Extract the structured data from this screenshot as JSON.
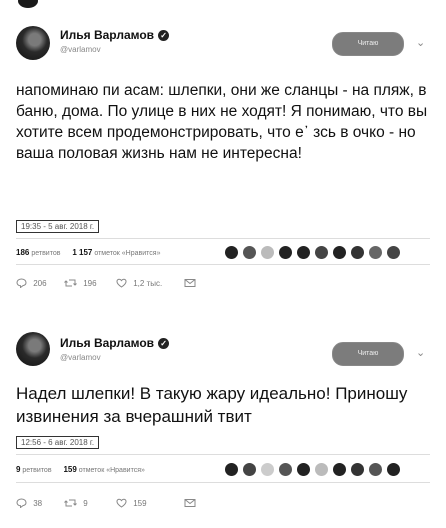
{
  "tweets": [
    {
      "author_name": "Илья Варламов",
      "handle": "@varlamov",
      "follow_label": "Читаю",
      "text": "напоминаю пи      асам: шлепки, они же сланцы - на пляж, в баню, дома. По улице в них не ходят! Я понимаю, что вы хотите всем продемонстрировать, что е᾽    зсь в очко - но ваша половая жизнь нам не интересна!",
      "timestamp": "19:35 - 5 авг. 2018 г.",
      "retweets_count": "186",
      "retweets_label": "ретвитов",
      "likes_count": "1 157",
      "likes_label": "отметок «Нравится»",
      "reply_count": "206",
      "retweet_action_count": "196",
      "like_action_count": "1,2 тыс."
    },
    {
      "author_name": "Илья Варламов",
      "handle": "@varlamov",
      "follow_label": "Читаю",
      "text": "Надел шлепки! В такую жару идеально! Приношу извинения за вчерашний твит",
      "timestamp": "12:56 - 6 авг. 2018 г.",
      "retweets_count": "9",
      "retweets_label": "ретвитов",
      "likes_count": "159",
      "likes_label": "отметок «Нравится»",
      "reply_count": "38",
      "retweet_action_count": "9",
      "like_action_count": "159"
    }
  ],
  "icons": {
    "verified": "verified-badge-icon",
    "chevron": "chevron-down-icon",
    "reply": "reply-icon",
    "retweet": "retweet-icon",
    "like": "heart-icon",
    "message": "direct-message-icon"
  }
}
